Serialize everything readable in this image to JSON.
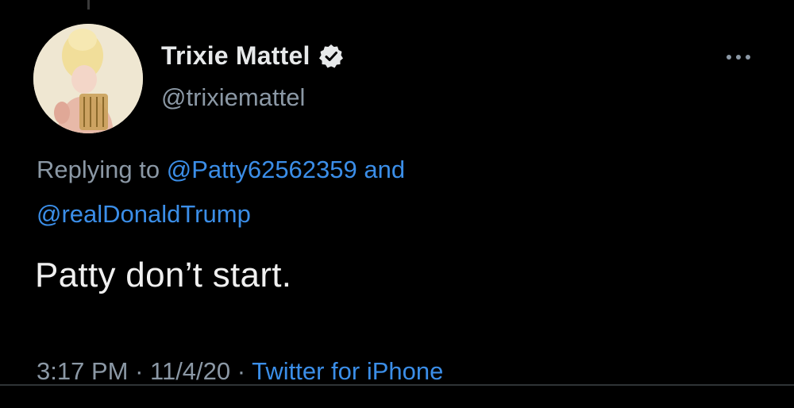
{
  "tweet": {
    "display_name": "Trixie Mattel",
    "handle": "@trixiemattel",
    "replying_prefix": "Replying to ",
    "mention_1": "@Patty62562359",
    "replying_and": " and",
    "mention_2": "@realDonaldTrump",
    "text": "Patty don’t start.",
    "time": "3:17 PM",
    "separator": " · ",
    "date": "11/4/20",
    "source": "Twitter for iPhone"
  },
  "icons": {
    "verified": "verified-badge-icon",
    "more": "more-options-icon"
  },
  "colors": {
    "background": "#000000",
    "primary_text": "#e7e9ea",
    "secondary_text": "#8b98a5",
    "link": "#3b8ee8"
  }
}
